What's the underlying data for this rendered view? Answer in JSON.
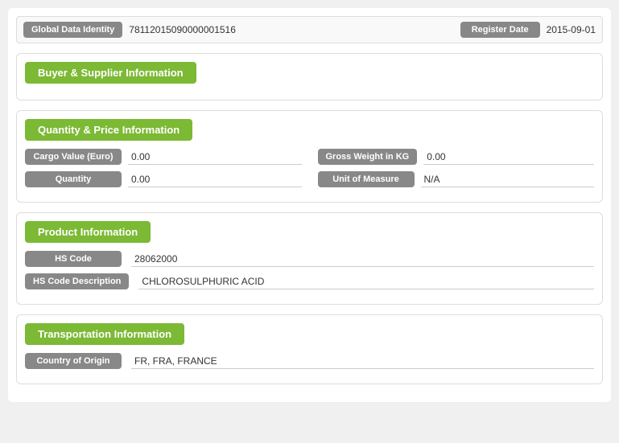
{
  "topBar": {
    "globalDataIdentityLabel": "Global Data Identity",
    "globalDataIdentityValue": "78112015090000001516",
    "registerDateLabel": "Register Date",
    "registerDateValue": "2015-09-01"
  },
  "sections": {
    "buyerSupplier": {
      "header": "Buyer & Supplier Information"
    },
    "quantityPrice": {
      "header": "Quantity & Price Information",
      "cargoValueLabel": "Cargo Value (Euro)",
      "cargoValueValue": "0.00",
      "grossWeightLabel": "Gross Weight in KG",
      "grossWeightValue": "0.00",
      "quantityLabel": "Quantity",
      "quantityValue": "0.00",
      "unitOfMeasureLabel": "Unit of Measure",
      "unitOfMeasureValue": "N/A"
    },
    "product": {
      "header": "Product Information",
      "hsCodeLabel": "HS Code",
      "hsCodeValue": "28062000",
      "hsCodeDescLabel": "HS Code Description",
      "hsCodeDescValue": "CHLOROSULPHURIC ACID"
    },
    "transportation": {
      "header": "Transportation Information",
      "countryOfOriginLabel": "Country of Origin",
      "countryOfOriginValue": "FR, FRA, FRANCE"
    }
  }
}
